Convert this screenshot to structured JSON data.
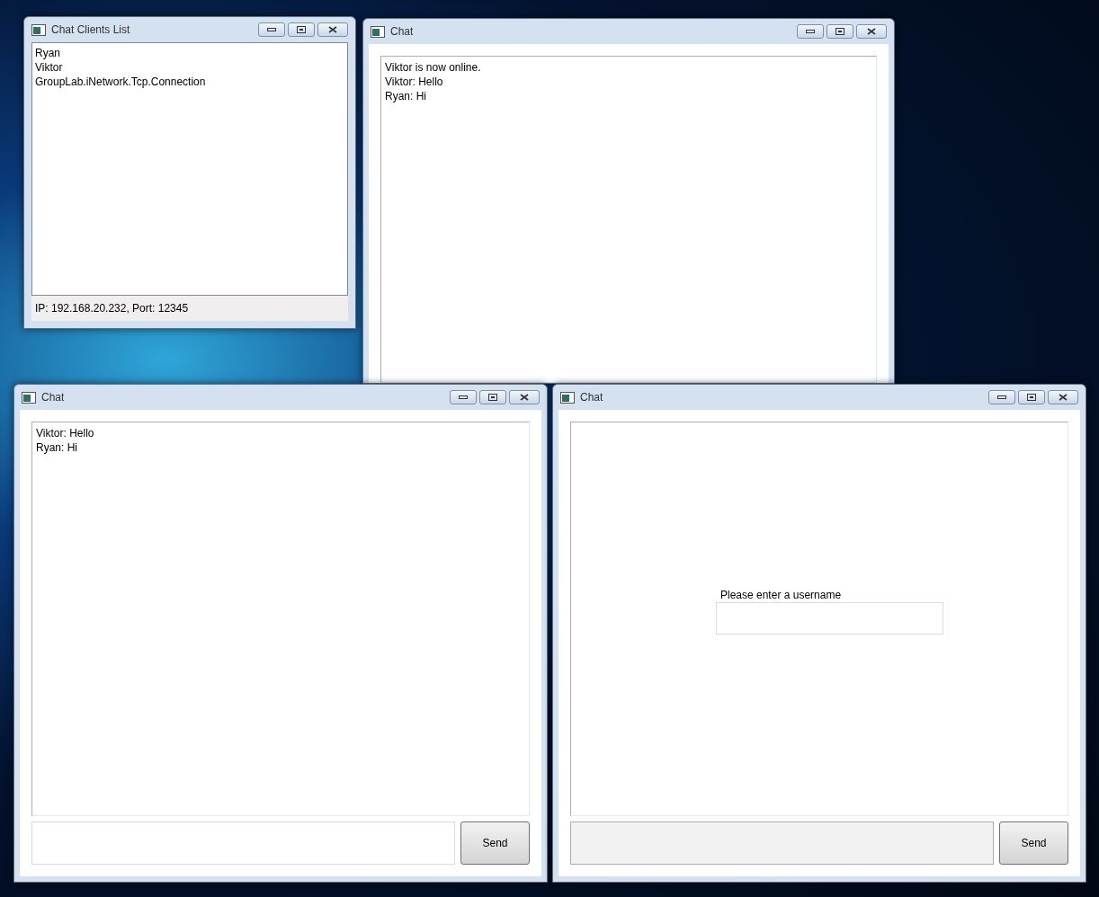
{
  "windows": [
    {
      "kind": "clients",
      "title": "Chat Clients List",
      "clients": [
        "Ryan",
        "Viktor",
        "GroupLab.iNetwork.Tcp.Connection"
      ],
      "status": "IP: 192.168.20.232, Port: 12345"
    },
    {
      "kind": "chat",
      "title": "Chat",
      "messages": [
        "Viktor is now online.",
        "Viktor: Hello",
        "Ryan: Hi"
      ]
    },
    {
      "kind": "chat",
      "title": "Chat",
      "messages": [
        "Viktor: Hello",
        "Ryan: Hi"
      ],
      "input": {
        "disabled": false
      },
      "send": "Send"
    },
    {
      "kind": "chat",
      "title": "Chat",
      "prompt": {
        "label": "Please enter a username"
      },
      "input": {
        "disabled": true
      },
      "send": "Send"
    }
  ]
}
